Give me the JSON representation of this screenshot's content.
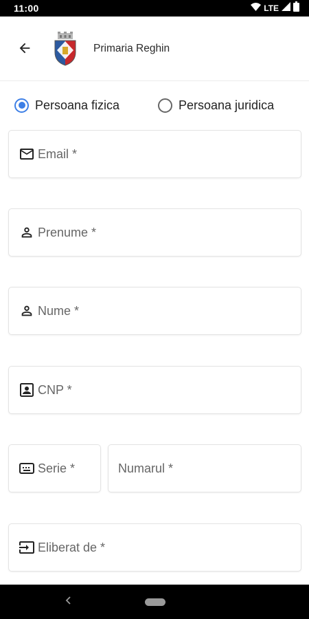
{
  "status_bar": {
    "time": "11:00",
    "network": "LTE"
  },
  "header": {
    "title": "Primaria Reghin",
    "back_icon": "arrow-back-icon"
  },
  "person_type": {
    "options": [
      {
        "label": "Persoana fizica",
        "selected": true
      },
      {
        "label": "Persoana juridica",
        "selected": false
      }
    ],
    "accent_color": "#3d7fe6"
  },
  "form": {
    "email": {
      "placeholder": "Email *",
      "icon": "mail-icon"
    },
    "first_name": {
      "placeholder": "Prenume *",
      "icon": "person-icon"
    },
    "last_name": {
      "placeholder": "Nume *",
      "icon": "person-icon"
    },
    "cnp": {
      "placeholder": "CNP *",
      "icon": "id-card-icon"
    },
    "series": {
      "placeholder": "Serie *",
      "icon": "keyboard-icon"
    },
    "number": {
      "placeholder": "Numarul *"
    },
    "issued_by": {
      "placeholder": "Eliberat de *",
      "icon": "input-icon"
    }
  }
}
